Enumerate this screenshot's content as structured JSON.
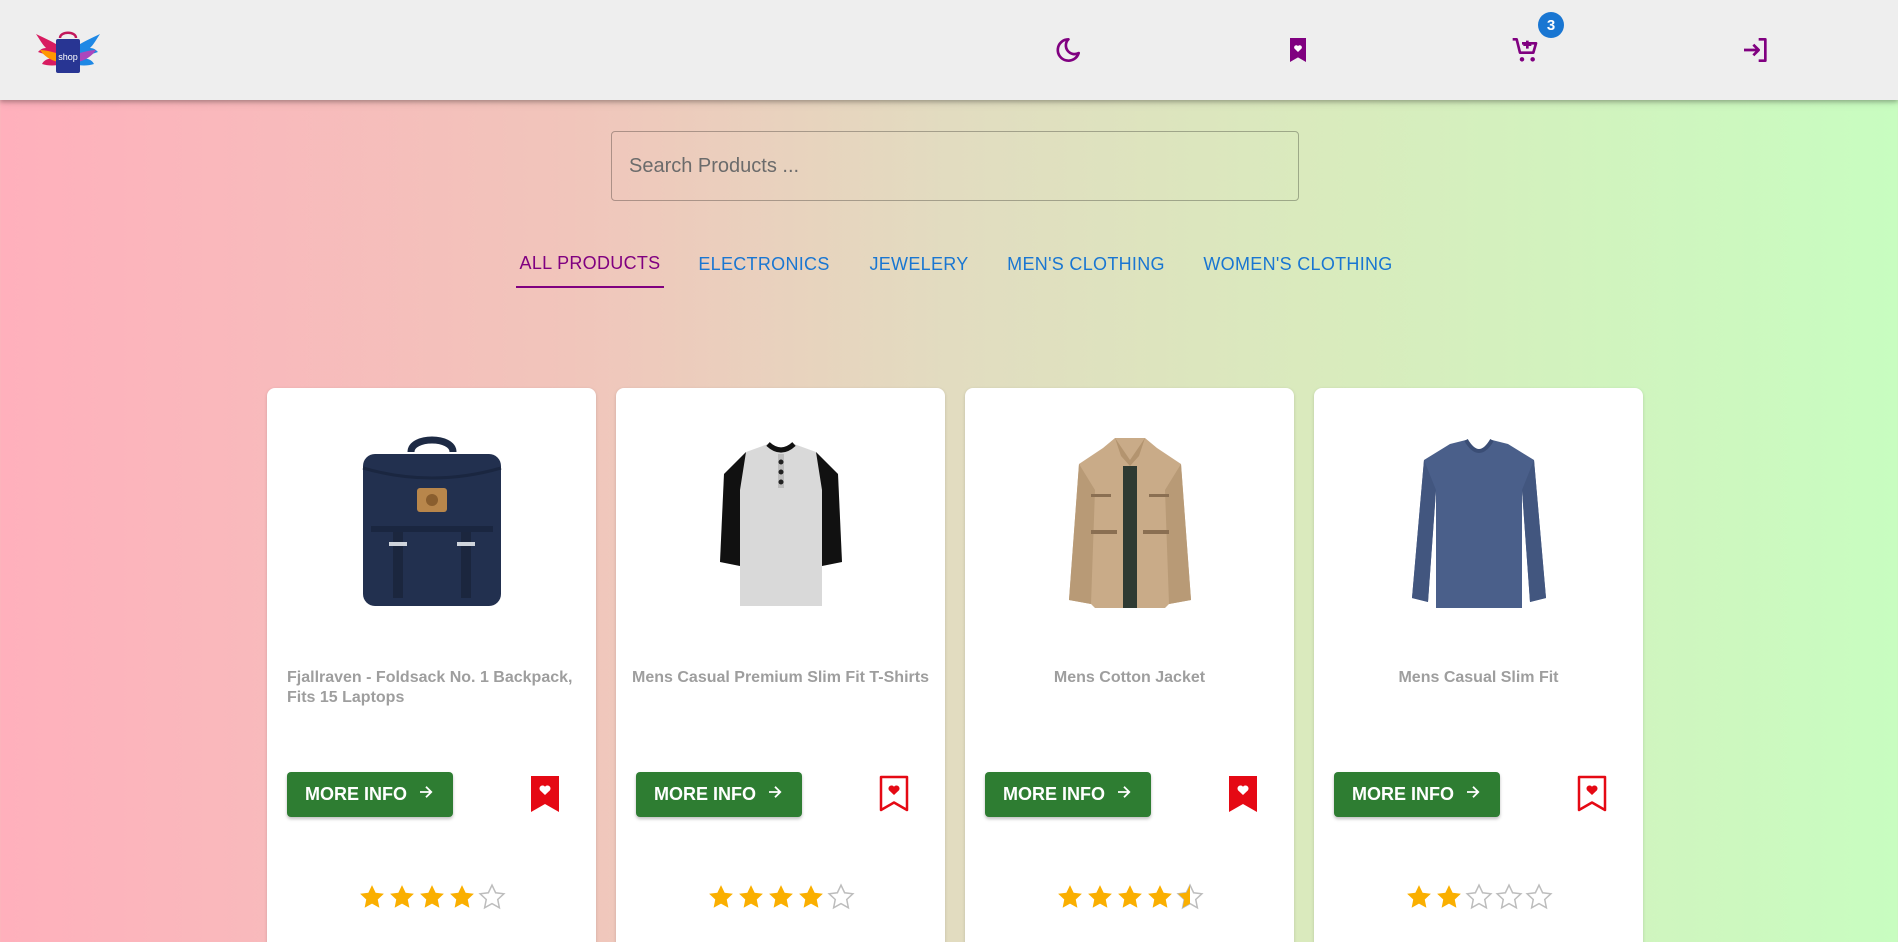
{
  "header": {
    "logo_text": "shop",
    "cart_count": "3",
    "icons": [
      "moon-icon",
      "bookmark-icon",
      "cart-icon",
      "login-icon"
    ],
    "accent_color": "#800080",
    "badge_color": "#1976d2"
  },
  "search": {
    "placeholder": "Search Products ..."
  },
  "tabs": [
    {
      "label": "ALL PRODUCTS",
      "active": true
    },
    {
      "label": "ELECTRONICS",
      "active": false
    },
    {
      "label": "JEWELERY",
      "active": false
    },
    {
      "label": "MEN'S CLOTHING",
      "active": false
    },
    {
      "label": "WOMEN'S CLOTHING",
      "active": false
    }
  ],
  "products": [
    {
      "title": "Fjallraven - Foldsack No. 1 Backpack, Fits 15 Laptops",
      "button": "MORE INFO",
      "bookmarked": true,
      "rating": 4,
      "image_icon": "backpack-image"
    },
    {
      "title": "Mens Casual Premium Slim Fit T-Shirts",
      "button": "MORE INFO",
      "bookmarked": false,
      "rating": 4,
      "image_icon": "tshirt-image"
    },
    {
      "title": "Mens Cotton Jacket",
      "button": "MORE INFO",
      "bookmarked": true,
      "rating": 4.5,
      "image_icon": "jacket-image"
    },
    {
      "title": "Mens Casual Slim Fit",
      "button": "MORE INFO",
      "bookmarked": false,
      "rating": 2,
      "image_icon": "longsleeve-image"
    }
  ],
  "colors": {
    "button_green": "#2e7d32",
    "bookmark_red": "#e50914",
    "star_gold": "#faaf00",
    "tab_blue": "#1976d2"
  }
}
